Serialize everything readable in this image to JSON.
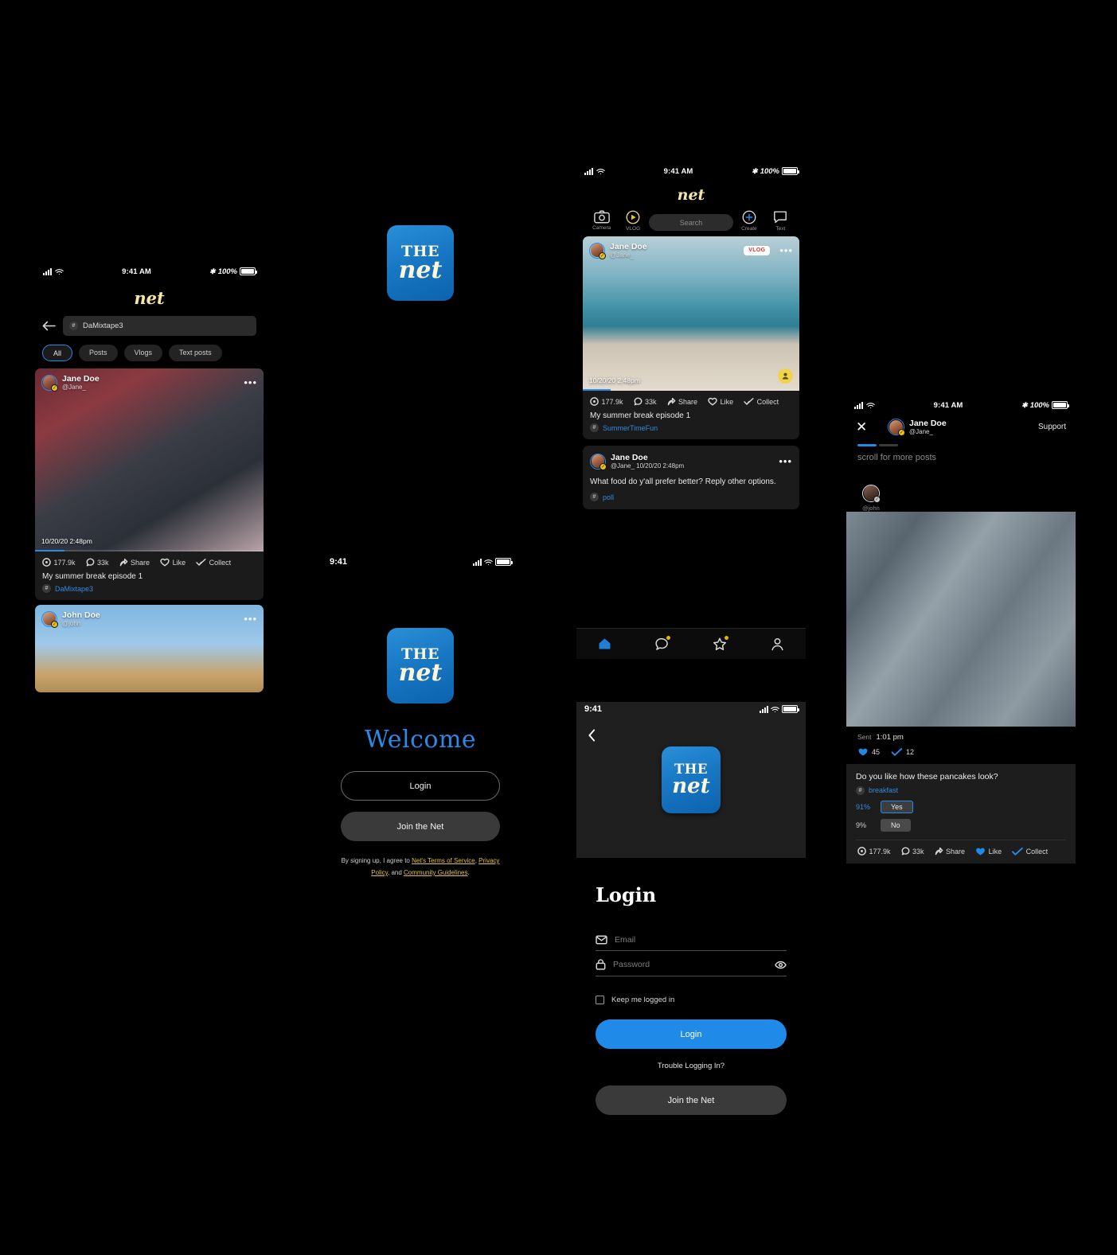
{
  "app": {
    "name": "net",
    "logo_the": "THE",
    "logo_net": "net"
  },
  "status_bar": {
    "time": "9:41 AM",
    "time_short": "9:41",
    "battery": "100%"
  },
  "screen_hashtag": {
    "search_value": "DaMixtape3",
    "back_icon": "back-arrow-icon",
    "filters": [
      {
        "label": "All",
        "active": true
      },
      {
        "label": "Posts",
        "active": false
      },
      {
        "label": "Vlogs",
        "active": false
      },
      {
        "label": "Text posts",
        "active": false
      }
    ],
    "posts": [
      {
        "name": "Jane Doe",
        "handle": "@Jane_",
        "timestamp": "10/20/20  2:48pm",
        "views": "177.9k",
        "comments": "33k",
        "share": "Share",
        "like": "Like",
        "collect": "Collect",
        "caption": "My summer break episode 1",
        "tag": "DaMixtape3",
        "progress_pct": 13
      },
      {
        "name": "John Doe",
        "handle": "@john"
      }
    ]
  },
  "screen_welcome": {
    "heading": "Welcome",
    "login_label": "Login",
    "join_label": "Join the Net",
    "terms_prefix": "By signing up, I agree to ",
    "terms_link_1": "Net's Terms of Service",
    "terms_sep_1": ", ",
    "terms_link_2": "Privacy Policy",
    "terms_sep_2": ", and ",
    "terms_link_3": "Community Guidelines",
    "terms_suffix": "."
  },
  "screen_feed": {
    "tools": [
      {
        "label": "Camera",
        "icon": "camera-icon"
      },
      {
        "label": "VLOG",
        "icon": "play-circle-icon"
      },
      {
        "label": "Create",
        "icon": "plus-circle-icon"
      },
      {
        "label": "Text",
        "icon": "speech-square-icon"
      }
    ],
    "search_placeholder": "Search",
    "vlog_post": {
      "name": "Jane Doe",
      "handle": "@Jane_",
      "badge": "VLOG",
      "timestamp": "10/20/20  2:48pm",
      "views": "177.9k",
      "comments": "33k",
      "share": "Share",
      "like": "Like",
      "collect": "Collect",
      "caption": "My summer break episode 1",
      "tag": "SummerTimeFun",
      "progress_pct": 13
    },
    "text_post": {
      "name": "Jane Doe",
      "meta": "@Jane_  10/20/20  2:48pm",
      "body": "What food do y'all prefer better? Reply other options.",
      "tag": "poll"
    },
    "nav": [
      {
        "name": "home",
        "icon": "home-icon",
        "active": true,
        "badge": false
      },
      {
        "name": "messages",
        "icon": "chat-bubble-icon",
        "active": false,
        "badge": true
      },
      {
        "name": "favorites",
        "icon": "star-icon",
        "active": false,
        "badge": true
      },
      {
        "name": "profile",
        "icon": "person-icon",
        "active": false,
        "badge": false
      }
    ]
  },
  "screen_login": {
    "back_icon": "chevron-left-icon",
    "title": "Login",
    "email_placeholder": "Email",
    "email_icon": "mail-icon",
    "password_placeholder": "Password",
    "password_icon": "lock-icon",
    "reveal_icon": "eye-icon",
    "keep_logged_label": "Keep me logged in",
    "login_label": "Login",
    "trouble_label": "Trouble Logging In?",
    "join_label": "Join the Net"
  },
  "screen_story": {
    "close_icon": "close-icon",
    "name": "Jane Doe",
    "handle": "@Jane_",
    "support_label": "Support",
    "progress_segments": 2,
    "progress_active": 1,
    "scroll_hint": "scroll for more posts",
    "sender_handle": "@john",
    "sent_label": "Sent",
    "sent_time": "1:01 pm",
    "reactions": [
      {
        "icon": "heart-icon",
        "count": "45"
      },
      {
        "icon": "check-icon",
        "count": "12"
      }
    ],
    "poll": {
      "question": "Do you like how these pancakes look?",
      "tag": "breakfast",
      "options": [
        {
          "pct": "91%",
          "label": "Yes",
          "selected": true
        },
        {
          "pct": "9%",
          "label": "No",
          "selected": false
        }
      ]
    },
    "footer": {
      "views": "177.9k",
      "comments": "33k",
      "share": "Share",
      "like": "Like",
      "collect": "Collect"
    }
  },
  "colors": {
    "accent": "#1f8ae8",
    "gold": "#f5e6a8",
    "link": "#e3c23a",
    "tag": "#2f8ae0",
    "vlog": "#d4362f"
  }
}
